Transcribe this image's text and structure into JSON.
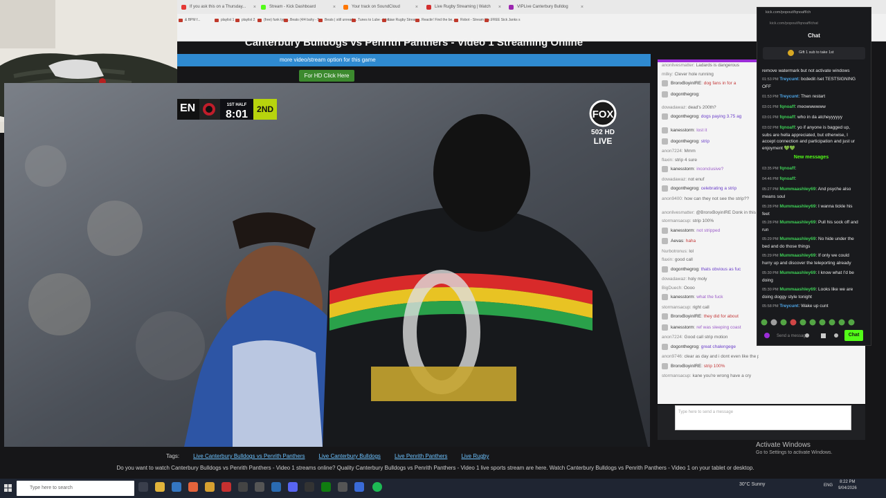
{
  "tabs": [
    {
      "label": "If you ask this on a Thursday...",
      "color": "#e53935"
    },
    {
      "label": "Stream - Kick Dashboard",
      "color": "#53fc18"
    },
    {
      "label": "Your track on SoundCloud",
      "color": "#ff7700"
    },
    {
      "label": "Live Rugby Streaming | Watch",
      "color": "#d32f2f"
    },
    {
      "label": "VIPLive Canterbury Bulldog",
      "color": "#9c27b0"
    }
  ],
  "bookmarks": [
    "& BPM f...",
    "playlist 1",
    "playlist 2",
    "(free) funk type...",
    "Beats (4/4 bahy - 5...",
    "Beats | still unready...",
    "Tunes to Lube - Upto...",
    "Live Rugby Stream...",
    "Reactin' Find the be...",
    "Robot - Stream Mo...",
    "FREE Sick Janks s"
  ],
  "page": {
    "title": "Canterbury Bulldogs vs Penrith Panthers - Video 1 Streaming Online",
    "more_option": "more video/stream option for this game",
    "hd_button": "For HD Click Here"
  },
  "scorebug": {
    "team": "EN",
    "half": "1ST HALF",
    "clock": "8:01",
    "period": "2ND"
  },
  "fox": {
    "brand": "FOX",
    "channel": "502 HD",
    "live": "LIVE"
  },
  "site_chat": [
    {
      "user": "anonlivesmatter",
      "text": "Ladards is dangerous",
      "style": "u"
    },
    {
      "user": "milky",
      "text": "Clever hole running",
      "style": "u"
    },
    {
      "user": "BronxBoyinIRE",
      "text": "dog fans in for a",
      "style": "red"
    },
    {
      "user": "dogonthegrog",
      "text": "",
      "style": "nm"
    },
    {
      "user": "dowadawaz",
      "text": "dead's 200th?",
      "style": "u"
    },
    {
      "user": "dogonthegrog",
      "text": "dogs paying 3.75 ag",
      "style": "nm"
    },
    {
      "user": "kanesstorm",
      "text": "lost it",
      "style": "pur"
    },
    {
      "user": "dogonthegrog",
      "text": "strip",
      "style": "nm"
    },
    {
      "user": "anon7224",
      "text": "Mmm",
      "style": "u"
    },
    {
      "user": "flaxin",
      "text": "strip 4 sure",
      "style": "u"
    },
    {
      "user": "kanesstorm",
      "text": "inconclusive?",
      "style": "pur"
    },
    {
      "user": "dowadawaz",
      "text": "not enuf",
      "style": "u"
    },
    {
      "user": "dogonthegrog",
      "text": "celebrating a strip",
      "style": "nm"
    },
    {
      "user": "anon9400",
      "text": "how can they not see the strip??",
      "style": "u"
    },
    {
      "user": "anonlivesmatter",
      "text": "@BronxBoyinIRE Donk in this game",
      "style": "u"
    },
    {
      "user": "stormansacup",
      "text": "strip 100%",
      "style": "u"
    },
    {
      "user": "kanesstorm",
      "text": "not stripped",
      "style": "pur"
    },
    {
      "user": "Aevas",
      "text": "haha",
      "style": "red"
    },
    {
      "user": "Nurbotronus",
      "text": "lol",
      "style": "u"
    },
    {
      "user": "flaxin",
      "text": "good call",
      "style": "u"
    },
    {
      "user": "dogonthegrog",
      "text": "thats obvious as fuc",
      "style": "nm"
    },
    {
      "user": "dowadawaz",
      "text": "holy moly",
      "style": "u"
    },
    {
      "user": "BigDuech",
      "text": "Oooo",
      "style": "u"
    },
    {
      "user": "kanesstorm",
      "text": "what the fuck",
      "style": "pur"
    },
    {
      "user": "stormansacup",
      "text": "right call",
      "style": "u"
    },
    {
      "user": "BronxBoyinIRE",
      "text": "they did for about",
      "style": "red"
    },
    {
      "user": "kanesstorm",
      "text": "ref was sleeping coast",
      "style": "pur"
    },
    {
      "user": "anon7224",
      "text": "Good call strip motion",
      "style": "u"
    },
    {
      "user": "dogonthegrog",
      "text": "great chalengege",
      "style": "nm"
    },
    {
      "user": "anon9746",
      "text": "clear as day and i dont even like the panthers",
      "style": "u"
    },
    {
      "user": "BronxBoyinIRE",
      "text": "strip 100%",
      "style": "red"
    },
    {
      "user": "stormansacup",
      "text": "kane you're wrong have a cry",
      "style": "u"
    }
  ],
  "site_chat_input": {
    "placeholder": "Type here to send a message"
  },
  "popup": {
    "url_top": "kick.com/popout/fqnoaff/ch",
    "url": "kick.com/popout/fqnoaff/chat",
    "header": "Chat",
    "gift": "Gift 1 sub to take 1st",
    "new_messages": "New messages",
    "send_placeholder": "Send a message",
    "chat_button": "Chat"
  },
  "kick_chat": [
    {
      "time": "",
      "user": "",
      "text": "remove watermark but not activate windows",
      "cls": ""
    },
    {
      "time": "01:53 PM",
      "user": "Treycunt",
      "text": "bcdedit /set TESTSIGNING OFF",
      "cls": "nb"
    },
    {
      "time": "01:53 PM",
      "user": "Treycunt",
      "text": "Then restart",
      "cls": "nb"
    },
    {
      "time": "03:01 PM",
      "user": "fqnoaff",
      "text": "meowwwwww",
      "cls": "nm"
    },
    {
      "time": "03:01 PM",
      "user": "fqnoaff",
      "text": "who in da atcheyyyyyy",
      "cls": "nm"
    },
    {
      "time": "03:02 PM",
      "user": "fqnoaff",
      "text": "yo if anyone is bagged up, subs are hella appreciated, but otherwise, I accept connection and participation and just ur enjoyment 💚💚",
      "cls": "nm"
    },
    {
      "time": "03:35 PM",
      "user": "fqnoaff",
      "text": "",
      "cls": "nm"
    },
    {
      "time": "04:46 PM",
      "user": "fqnoaff",
      "text": "",
      "cls": "nm"
    },
    {
      "time": "05:27 PM",
      "user": "Mummaashley69",
      "text": "And psyche also means soul",
      "cls": "nm"
    },
    {
      "time": "05:28 PM",
      "user": "Mummaashley69",
      "text": "I wanna tickle his feet",
      "cls": "nm"
    },
    {
      "time": "05:28 PM",
      "user": "Mummaashley69",
      "text": "Pull his sock off and run",
      "cls": "nm"
    },
    {
      "time": "05:29 PM",
      "user": "Mummaashley69",
      "text": "No hide under the bed and do those things",
      "cls": "nm"
    },
    {
      "time": "05:29 PM",
      "user": "Mummaashley69",
      "text": "If only we could hurry up and discover the teleporting already",
      "cls": "nm"
    },
    {
      "time": "05:30 PM",
      "user": "Mummaashley69",
      "text": "I know what I'd be doing",
      "cls": "nm"
    },
    {
      "time": "05:30 PM",
      "user": "Mummaashley69",
      "text": "Looks like we are doing doggy style tonight",
      "cls": "nm"
    },
    {
      "time": "05:58 PM",
      "user": "Treycunt",
      "text": "Wake up cunt",
      "cls": "nb"
    }
  ],
  "footer": {
    "tags_label": "Tags:",
    "tags": [
      "Live Canterbury Bulldogs vs Penrith Panthers",
      "Live Canterbury Bulldogs",
      "Live Penrith Panthers",
      "Live Rugby"
    ],
    "description": "Do you want to watch Canterbury Bulldogs vs Penrith Panthers - Video 1 streams online? Quality Canterbury Bulldogs vs Penrith Panthers - Video 1 live sports stream are here. Watch Canterbury Bulldogs vs Penrith Panthers - Video 1 on your tablet or desktop."
  },
  "activate": {
    "title": "Activate Windows",
    "sub": "Go to Settings to activate Windows."
  },
  "taskbar": {
    "search": "Type here to search",
    "weather": "30°C Sunny",
    "lang": "ENG",
    "time": "8:22 PM",
    "date": "9/04/2026"
  }
}
